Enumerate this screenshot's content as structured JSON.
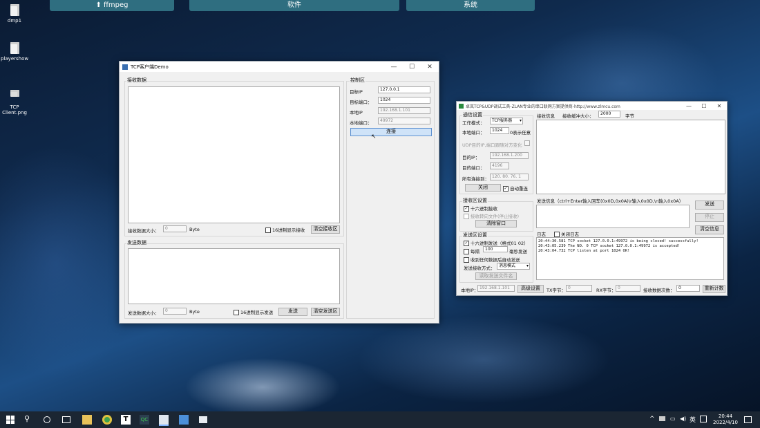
{
  "topbar": {
    "ffmpeg": "⬆ ffmpeg",
    "software": "软件",
    "system": "系统"
  },
  "desktop": {
    "icons": [
      {
        "label": "dmp1"
      },
      {
        "label": "playershow"
      },
      {
        "label": "TCP\nClient.png"
      }
    ]
  },
  "tcp_demo": {
    "title": "TCP客户端Demo",
    "receive_group": "接收数据",
    "recv_size_label": "接收数据大小：",
    "recv_size_value": "0",
    "byte_unit": "Byte",
    "hex_recv": "16进制显示接收",
    "clear_recv": "清空接收区",
    "send_group": "发送数据",
    "send_size_label": "发送数据大小：",
    "send_size_value": "0",
    "hex_send": "16进制显示发送",
    "send_btn": "发送",
    "clear_send": "清空发送区",
    "control_group": "控制区",
    "target_ip_label": "目标IP",
    "target_ip": "127.0.0.1",
    "target_port_label": "目标端口：",
    "target_port": "1024",
    "local_ip_label": "本地IP",
    "local_ip": "192.168.1.101",
    "local_port_label": "本地端口：",
    "local_port": "49972",
    "connect_btn": "连接"
  },
  "zlan": {
    "title": "卓岚TCP&UDP调试工具-ZLAN专业的串口联网方案提供商-http://www.zlmcu.com",
    "net_settings": "通信设置",
    "work_mode_label": "工作模式：",
    "work_mode": "TCP服务器",
    "local_port_label": "本地端口：",
    "local_port": "1024",
    "zero_any": "0表示任意",
    "udp_note": "UDP目的IP,端口跟随对方变化",
    "dest_ip_label": "目的IP：",
    "dest_ip": "192.168.1.200",
    "dest_port_label": "目的端口：",
    "dest_port": "4196",
    "client_label": "所有连接到：",
    "client_val": "120. 80. 76. 1",
    "close_btn": "关闭",
    "auto_connect": "自动重连",
    "recv_settings": "接收区设置",
    "hex_show": "十六进制接收",
    "save_file": "接收转向文件(停止接收)",
    "clear_recv_win": "清除窗口",
    "send_settings": "发送区设置",
    "hex_send": "十六进制发送（格式01 02）",
    "loop_label": "每隔",
    "loop_val": "100",
    "loop_unit": "毫秒发送",
    "after_recv": "收到任何数据后自动发送",
    "send_mode_label": "发送接收方式：",
    "send_mode": "消息模式",
    "open_file": "读取发送文件名",
    "recv_info": "接收信息",
    "buf_label": "接收缓冲大小：",
    "buf_val": "2000",
    "byte_unit": "字节",
    "send_info_label": "发送信息（ctrl+Enter输入回车(0x0D,0x0A)\\r输入0x0D,\\n输入0x0A）",
    "send_btn": "发送",
    "stop_btn": "停止",
    "clear_info_btn": "清空信息",
    "log_label": "日志",
    "close_log": "关闭日志",
    "log_lines": [
      "20:44:30.581  TCP socket 127.0.0.1:49972 is being closed! successfully!",
      "20:43:05.239  The NO. 0 TCP socket 127.0.0.1:49972 is accepted!",
      "20:43:04.732  TCP listen at port 1024 OK!"
    ],
    "local_ip_label": "本地IP：",
    "local_ip": "192.168.1.101",
    "adv_settings": "高级设置",
    "tx_label": "TX字节：",
    "tx_val": "0",
    "rx_label": "RX字节：",
    "rx_val": "0",
    "count_label": "接收数据次数：",
    "count_val": "0",
    "reset_btn": "重新计数"
  },
  "taskbar": {
    "time": "20:44",
    "date": "2022/4/10",
    "lang": "英"
  },
  "colors": {
    "accent": "#cfe3f8",
    "desktop": "#0f2a4d"
  }
}
